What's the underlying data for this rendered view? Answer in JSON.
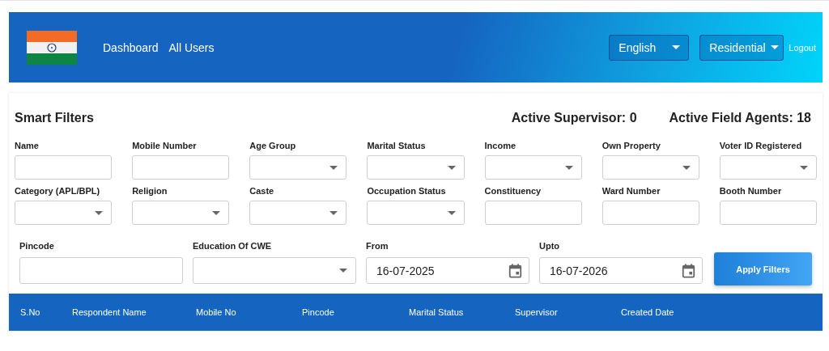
{
  "nav": {
    "links": [
      "Dashboard",
      "All Users"
    ],
    "language": "English",
    "area": "Residential",
    "logout": "Logout"
  },
  "filters": {
    "title": "Smart Filters",
    "stats": [
      "Active Supervisor: 0",
      "Active Field Agents: 18"
    ],
    "fields": [
      {
        "label": "Name",
        "kind": "text"
      },
      {
        "label": "Mobile Number",
        "kind": "text"
      },
      {
        "label": "Age Group",
        "kind": "select"
      },
      {
        "label": "Marital Status",
        "kind": "select"
      },
      {
        "label": "Income",
        "kind": "select"
      },
      {
        "label": "Own Property",
        "kind": "select"
      },
      {
        "label": "Voter ID Registered",
        "kind": "select"
      },
      {
        "label": "Category (APL/BPL)",
        "kind": "select"
      },
      {
        "label": "Religion",
        "kind": "select"
      },
      {
        "label": "Caste",
        "kind": "select"
      },
      {
        "label": "Occupation Status",
        "kind": "select"
      },
      {
        "label": "Constituency",
        "kind": "text"
      },
      {
        "label": "Ward Number",
        "kind": "text"
      },
      {
        "label": "Booth Number",
        "kind": "text"
      }
    ],
    "row3": [
      {
        "label": "Pincode",
        "kind": "text"
      },
      {
        "label": "Education Of CWE",
        "kind": "select"
      },
      {
        "label": "From",
        "kind": "date",
        "value": "16-07-2025"
      },
      {
        "label": "Upto",
        "kind": "date",
        "value": "16-07-2026"
      }
    ],
    "apply": "Apply Filters"
  },
  "table": {
    "columns": [
      "S.No",
      "Respondent Name",
      "Mobile No",
      "Pincode",
      "Marital Status",
      "Supervisor",
      "Created Date"
    ]
  }
}
